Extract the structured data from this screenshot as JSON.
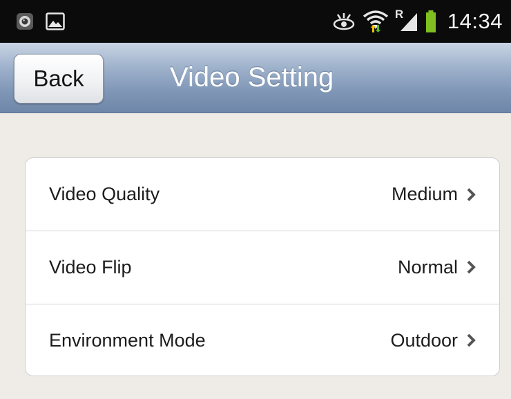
{
  "status_bar": {
    "time": "14:34",
    "left_icons": [
      "camera-app-icon",
      "image-icon"
    ],
    "right_icons": [
      "eye-icon",
      "wifi-icon",
      "signal-icon",
      "battery-icon"
    ],
    "roaming_label": "R"
  },
  "header": {
    "back_label": "Back",
    "title": "Video Setting"
  },
  "settings": [
    {
      "label": "Video Quality",
      "value": "Medium"
    },
    {
      "label": "Video Flip",
      "value": "Normal"
    },
    {
      "label": "Environment Mode",
      "value": "Outdoor"
    }
  ],
  "colors": {
    "header_gradient_top": "#c9d4e3",
    "header_gradient_bottom": "#6f87a8",
    "background": "#efece8",
    "battery": "#7fbf1f",
    "wifi_arrow": "#f2c300"
  }
}
